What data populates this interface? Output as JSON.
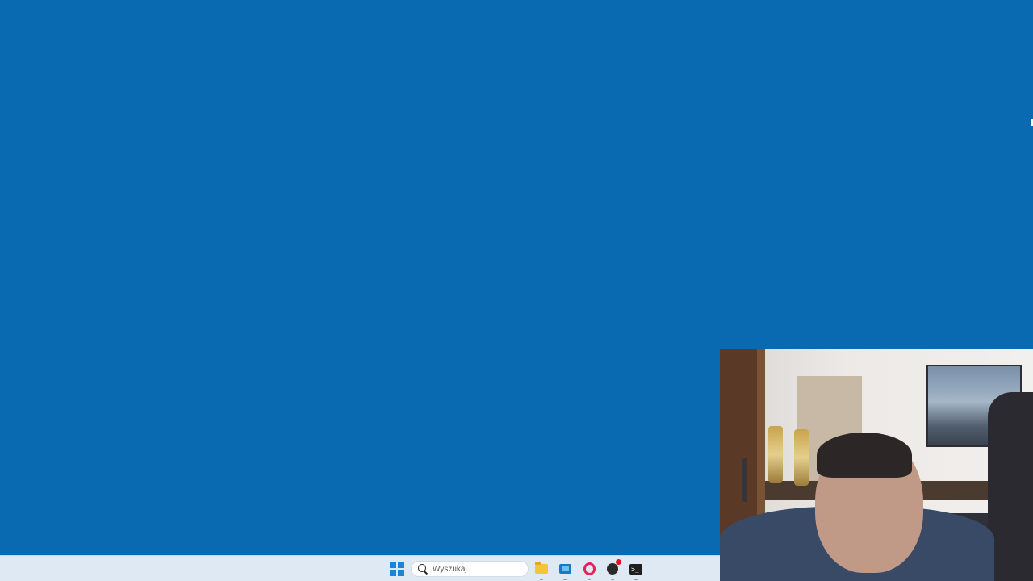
{
  "desktop": {
    "background_color": "#0969b1"
  },
  "taskbar": {
    "background_color": "#dfe9f3",
    "search": {
      "placeholder": "Wyszukaj"
    },
    "apps": [
      {
        "name": "file-explorer",
        "icon": "folder-icon"
      },
      {
        "name": "remote-desktop",
        "icon": "remote-desktop-icon"
      },
      {
        "name": "opera",
        "icon": "opera-icon"
      },
      {
        "name": "app-sphere",
        "icon": "sphere-icon"
      },
      {
        "name": "terminal",
        "icon": "terminal-icon"
      }
    ],
    "start_icon": "windows-start-icon"
  },
  "webcam": {
    "description_icon": "webcam-feed"
  }
}
